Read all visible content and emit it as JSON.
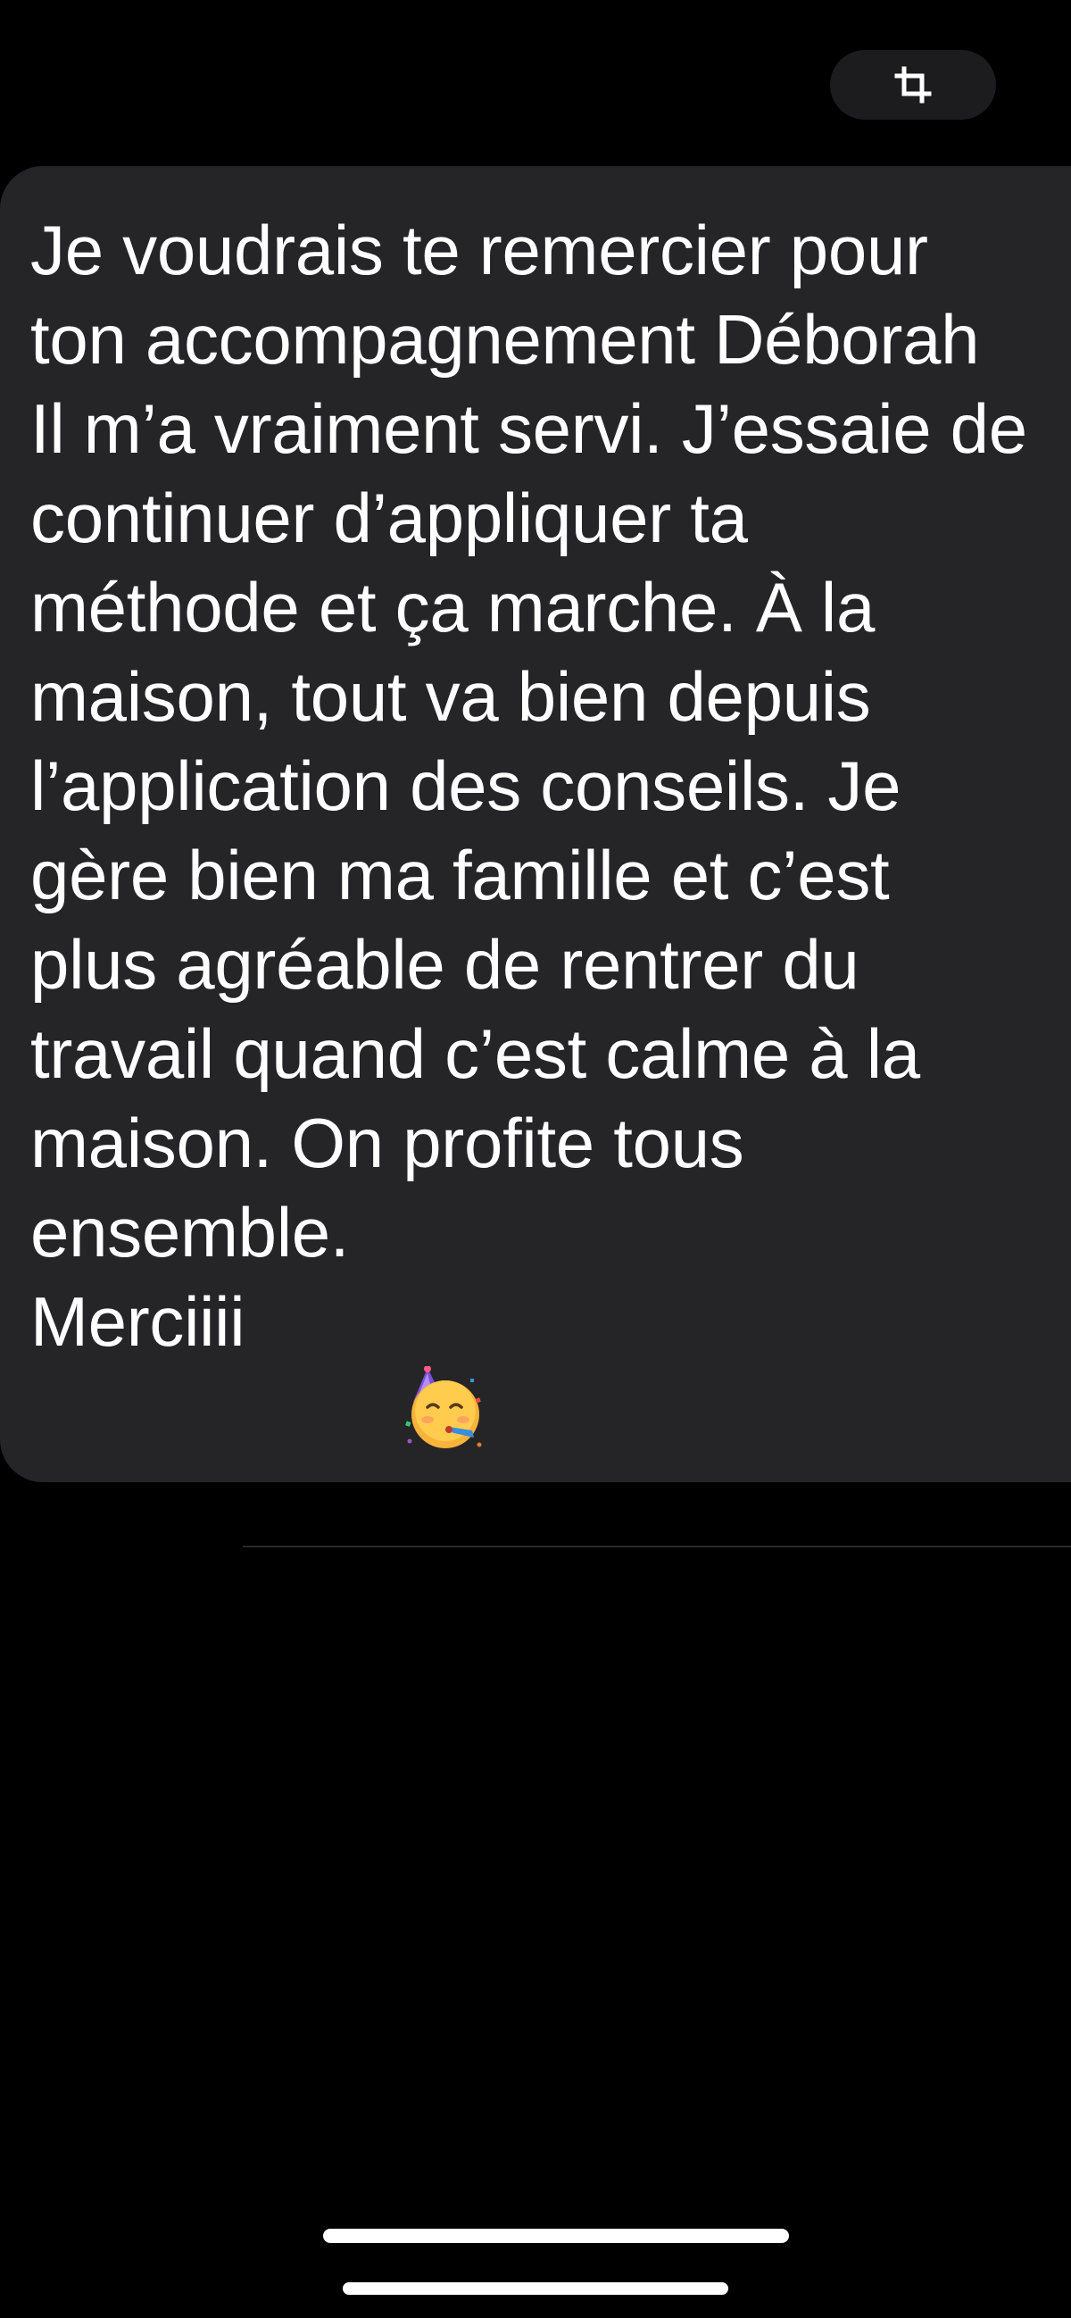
{
  "toolbar": {
    "crop_icon": "crop-icon"
  },
  "message": {
    "lines": [
      "Je voudrais te remercier pour",
      "ton accompagnement Déborah",
      "Il m’a vraiment servi. J’essaie de",
      "continuer d’appliquer ta",
      "méthode et ça marche. À la",
      "maison, tout va bien depuis",
      "l’application des conseils. Je",
      "gère bien ma famille et c’est",
      "plus agréable de rentrer du",
      "travail quand c’est calme à la",
      "maison. On profite tous",
      "ensemble."
    ],
    "last_line": "Merciiii",
    "emoji": "partying-face-emoji"
  },
  "colors": {
    "background": "#000000",
    "bubble": "#252528",
    "text": "#ffffff",
    "pill": "#1c1c1e"
  }
}
